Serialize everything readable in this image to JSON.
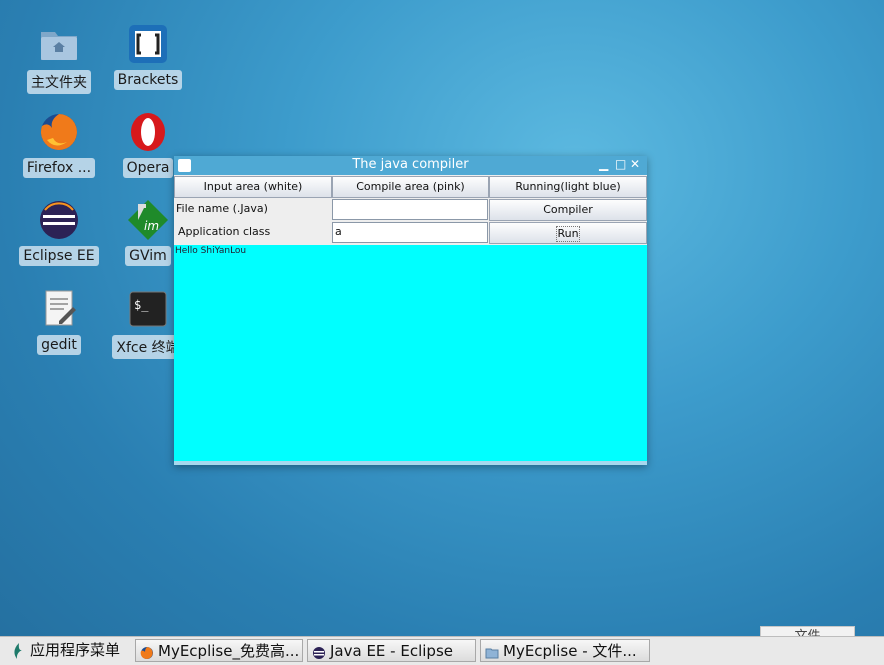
{
  "desktop": {
    "icons": [
      {
        "label": "主文件夹",
        "icon": "home-folder-icon"
      },
      {
        "label": "Brackets",
        "icon": "brackets-icon"
      },
      {
        "label": "Firefox ...",
        "icon": "firefox-icon"
      },
      {
        "label": "Opera",
        "icon": "opera-icon"
      },
      {
        "label": "Eclipse EE",
        "icon": "eclipse-icon"
      },
      {
        "label": "GVim",
        "icon": "gvim-icon"
      },
      {
        "label": "gedit",
        "icon": "gedit-icon"
      },
      {
        "label": "Xfce 终端",
        "icon": "terminal-icon"
      }
    ]
  },
  "window": {
    "title": "The java compiler",
    "controls": {
      "minimize": "▁",
      "maximize": "□",
      "close": "✕"
    },
    "headers": [
      "Input area (white)",
      "Compile area (pink)",
      "Running(light blue)"
    ],
    "file_label": "File name (.Java)",
    "file_value": "",
    "compiler_button": "Compiler",
    "class_label": "Application class",
    "class_value": "a",
    "run_button": "Run",
    "output": "Hello ShiYanLou"
  },
  "taskbar": {
    "menu": "应用程序菜单",
    "items": [
      "MyEcplise_免费高...",
      "Java EE - Eclipse",
      "MyEcplise - 文件..."
    ],
    "tray_text": "文件"
  },
  "colors": {
    "output_bg": "#00ffff",
    "titlebar": "#4fa9d4"
  }
}
